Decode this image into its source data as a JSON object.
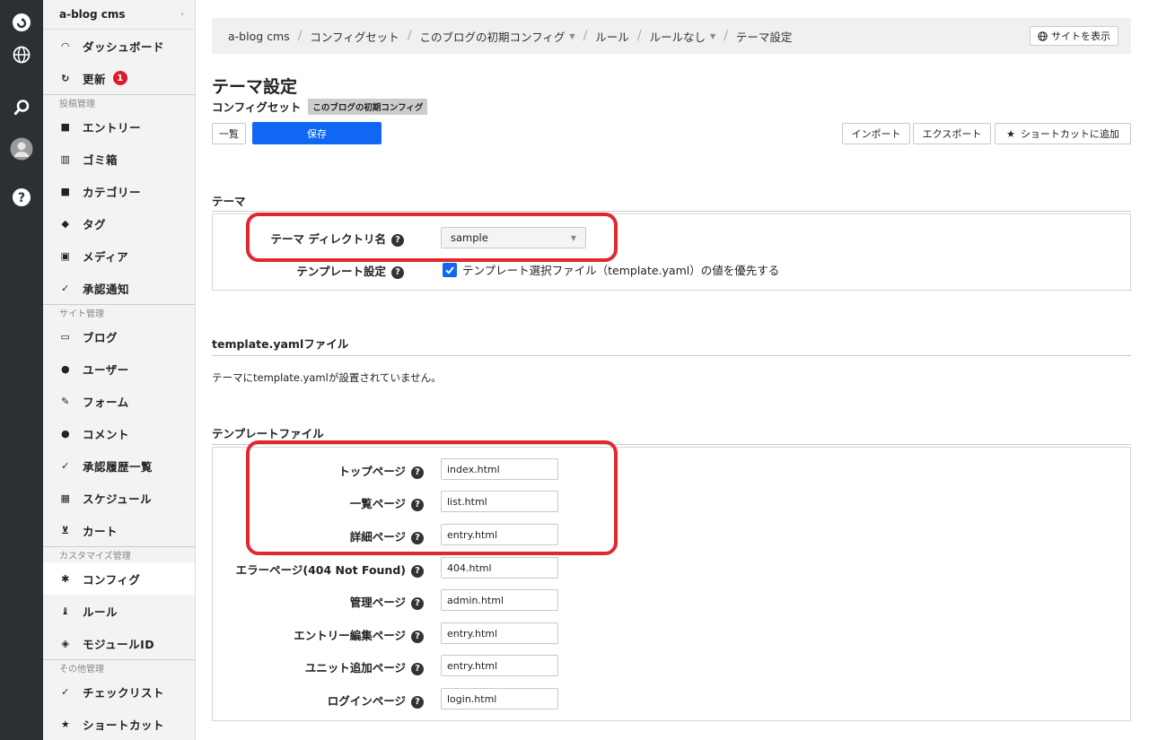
{
  "sidebar": {
    "site_name": "a-blog cms",
    "items": [
      {
        "label": "ダッシュボード"
      },
      {
        "label": "更新",
        "badge": "1"
      },
      {
        "label": "エントリー"
      },
      {
        "label": "ゴミ箱"
      },
      {
        "label": "カテゴリー"
      },
      {
        "label": "タグ"
      },
      {
        "label": "メディア"
      },
      {
        "label": "承認通知"
      },
      {
        "label": "ブログ"
      },
      {
        "label": "ユーザー"
      },
      {
        "label": "フォーム"
      },
      {
        "label": "コメント"
      },
      {
        "label": "承認履歴一覧"
      },
      {
        "label": "スケジュール"
      },
      {
        "label": "カート"
      },
      {
        "label": "コンフィグ"
      },
      {
        "label": "ルール"
      },
      {
        "label": "モジュールID"
      },
      {
        "label": "チェックリスト"
      },
      {
        "label": "ショートカット"
      }
    ],
    "heads": [
      "投稿管理",
      "サイト管理",
      "カスタマイズ管理",
      "その他管理"
    ]
  },
  "breadcrumb": {
    "items": [
      "a-blog cms",
      "コンフィグセット",
      "このブログの初期コンフィグ",
      "ルール",
      "ルールなし",
      "テーマ設定"
    ],
    "view_site": "サイトを表示"
  },
  "page": {
    "title": "テーマ設定",
    "subtitle": "コンフィグセット",
    "tag": "このブログの初期コンフィグ"
  },
  "toolbar": {
    "list": "一覧",
    "save": "保存",
    "import": "インポート",
    "export": "エクスポート",
    "shortcut": "ショートカットに追加"
  },
  "theme": {
    "section": "テーマ",
    "dir_label": "テーマ ディレクトリ名",
    "dir_value": "sample",
    "template_label": "テンプレート設定",
    "template_check": "テンプレート選択ファイル（template.yaml）の値を優先する"
  },
  "yaml": {
    "section": "template.yamlファイル",
    "message": "テーマにtemplate.yamlが設置されていません。"
  },
  "templates": {
    "section": "テンプレートファイル",
    "rows": [
      {
        "label": "トップページ",
        "value": "index.html"
      },
      {
        "label": "一覧ページ",
        "value": "list.html"
      },
      {
        "label": "詳細ページ",
        "value": "entry.html"
      },
      {
        "label": "エラーページ(404 Not Found)",
        "value": "404.html"
      },
      {
        "label": "管理ページ",
        "value": "admin.html"
      },
      {
        "label": "エントリー編集ページ",
        "value": "entry.html"
      },
      {
        "label": "ユニット追加ページ",
        "value": "entry.html"
      },
      {
        "label": "ログインページ",
        "value": "login.html"
      }
    ]
  },
  "colors": {
    "accent": "#1067f3",
    "highlight": "#e0282e",
    "badge": "#e0182d"
  }
}
